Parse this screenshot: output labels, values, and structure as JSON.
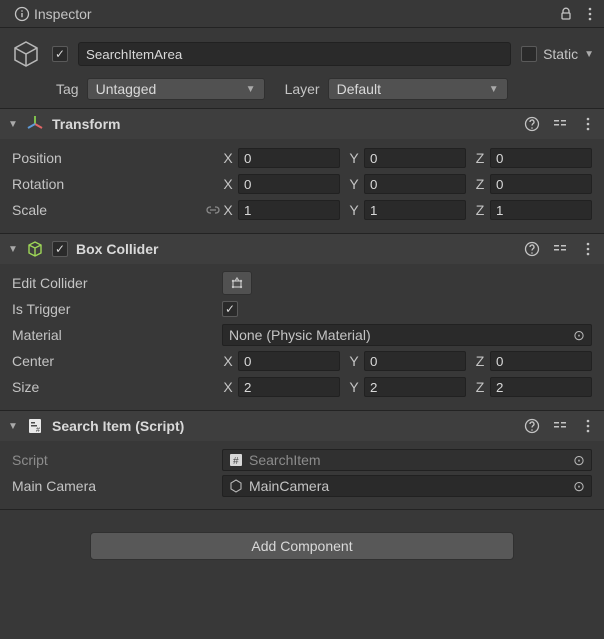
{
  "titlebar": {
    "title": "Inspector"
  },
  "header": {
    "active": true,
    "name": "SearchItemArea",
    "static_label": "Static",
    "static_checked": false,
    "tag_label": "Tag",
    "tag_value": "Untagged",
    "layer_label": "Layer",
    "layer_value": "Default"
  },
  "transform": {
    "title": "Transform",
    "position_label": "Position",
    "rotation_label": "Rotation",
    "scale_label": "Scale",
    "position": {
      "x": "0",
      "y": "0",
      "z": "0"
    },
    "rotation": {
      "x": "0",
      "y": "0",
      "z": "0"
    },
    "scale": {
      "x": "1",
      "y": "1",
      "z": "1"
    },
    "axis": {
      "x": "X",
      "y": "Y",
      "z": "Z"
    }
  },
  "box_collider": {
    "title": "Box Collider",
    "enabled": true,
    "edit_label": "Edit Collider",
    "is_trigger_label": "Is Trigger",
    "is_trigger": true,
    "material_label": "Material",
    "material_value": "None (Physic Material)",
    "center_label": "Center",
    "size_label": "Size",
    "center": {
      "x": "0",
      "y": "0",
      "z": "0"
    },
    "size": {
      "x": "2",
      "y": "2",
      "z": "2"
    },
    "axis": {
      "x": "X",
      "y": "Y",
      "z": "Z"
    }
  },
  "script": {
    "title": "Search Item (Script)",
    "script_label": "Script",
    "script_value": "SearchItem",
    "main_camera_label": "Main Camera",
    "main_camera_value": "MainCamera"
  },
  "footer": {
    "add_component": "Add Component"
  }
}
